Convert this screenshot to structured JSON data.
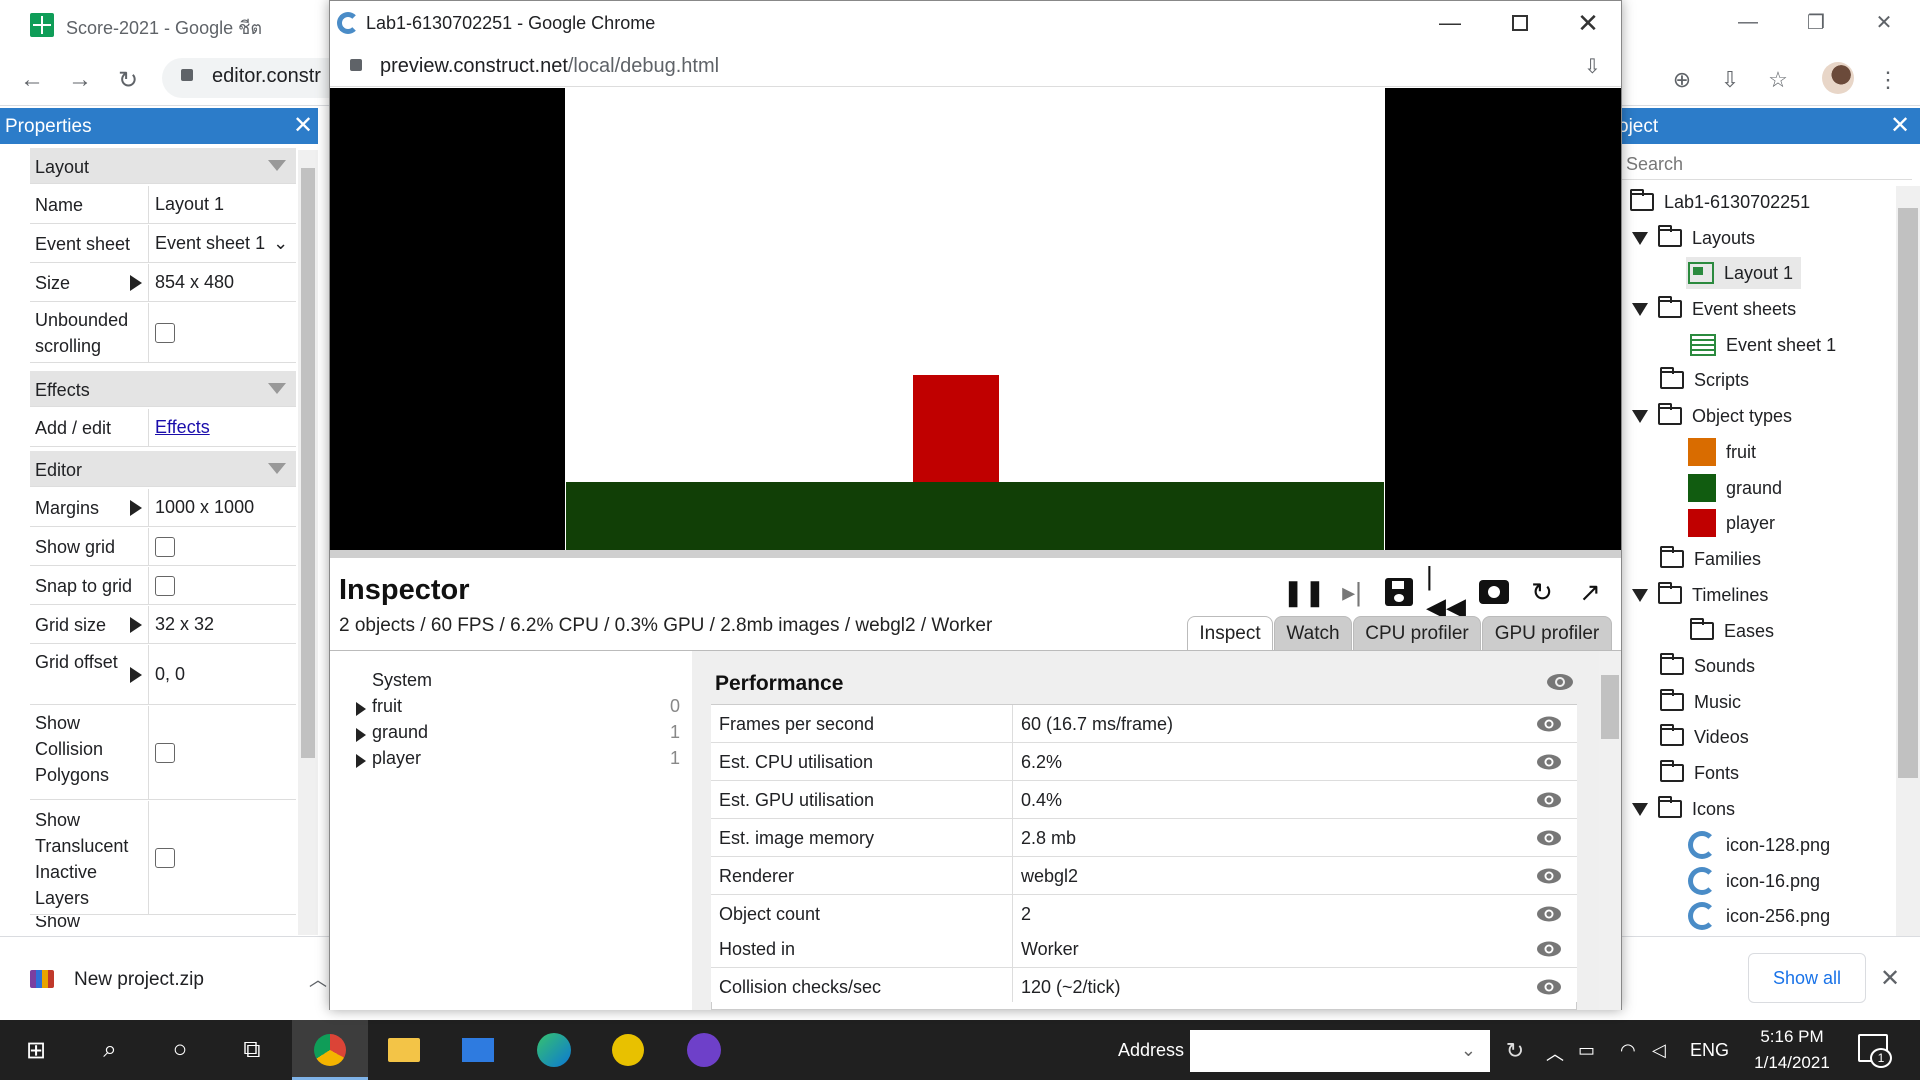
{
  "bg_window": {
    "tab_title": "Score-2021 - Google ชีต",
    "url_visible": "editor.constr"
  },
  "properties": {
    "title": "Properties",
    "rows": {
      "layout_section": "Layout",
      "name_label": "Name",
      "name_value": "Layout 1",
      "event_sheet_label": "Event sheet",
      "event_sheet_value": "Event sheet 1",
      "size_label": "Size",
      "size_value": "854 x 480",
      "unbounded_label": "Unbounded scrolling",
      "effects_section": "Effects",
      "add_edit_label": "Add / edit",
      "effects_link": "Effects",
      "editor_section": "Editor",
      "margins_label": "Margins",
      "margins_value": "1000 x 1000",
      "show_grid_label": "Show grid",
      "snap_label": "Snap to grid",
      "grid_size_label": "Grid size",
      "grid_size_value": "32 x 32",
      "grid_offset_label": "Grid offset",
      "grid_offset_value": "0, 0",
      "collision_label": "Show Collision Polygons",
      "translucent_label": "Show Translucent Inactive Layers",
      "cut_label": "Show"
    }
  },
  "project": {
    "title": "oject",
    "search_placeholder": "Search",
    "tree": {
      "root": "Lab1-6130702251",
      "layouts": "Layouts",
      "layout1": "Layout 1",
      "event_sheets": "Event sheets",
      "event_sheet1": "Event sheet 1",
      "scripts": "Scripts",
      "object_types": "Object types",
      "fruit": "fruit",
      "graund": "graund",
      "player": "player",
      "families": "Families",
      "timelines": "Timelines",
      "eases": "Eases",
      "sounds": "Sounds",
      "music": "Music",
      "videos": "Videos",
      "fonts": "Fonts",
      "icons": "Icons",
      "icon128": "icon-128.png",
      "icon16": "icon-16.png",
      "icon256": "icon-256.png"
    },
    "colors": {
      "fruit": "#d96c00",
      "graund": "#115c10",
      "player": "#c00000"
    }
  },
  "download": {
    "file": "New project.zip",
    "show_all": "Show all"
  },
  "taskbar": {
    "address_label": "Address",
    "lang": "ENG",
    "time": "5:16 PM",
    "date": "1/14/2021",
    "notif_count": "1"
  },
  "popup": {
    "title": "Lab1-6130702251 - Google Chrome",
    "url_host": "preview.construct.net",
    "url_path": "/local/debug.html",
    "inspector": {
      "title": "Inspector",
      "stats": "2 objects / 60 FPS / 6.2% CPU / 0.3% GPU / 2.8mb images / webgl2 / Worker",
      "tabs": [
        "Inspect",
        "Watch",
        "CPU profiler",
        "GPU profiler"
      ],
      "objects": {
        "system": "System",
        "items": [
          {
            "name": "fruit",
            "count": "0"
          },
          {
            "name": "graund",
            "count": "1"
          },
          {
            "name": "player",
            "count": "1"
          }
        ]
      },
      "performance": {
        "title": "Performance",
        "rows": [
          {
            "k": "Frames per second",
            "v": "60 (16.7 ms/frame)"
          },
          {
            "k": "Est. CPU utilisation",
            "v": "6.2%"
          },
          {
            "k": "Est. GPU utilisation",
            "v": "0.4%"
          },
          {
            "k": "Est. image memory",
            "v": "2.8 mb"
          },
          {
            "k": "Renderer",
            "v": "webgl2"
          },
          {
            "k": "Object count",
            "v": "2"
          },
          {
            "k": "Hosted in",
            "v": "Worker"
          },
          {
            "k": "Collision checks/sec",
            "v": "120 (~2/tick)"
          }
        ]
      }
    }
  }
}
